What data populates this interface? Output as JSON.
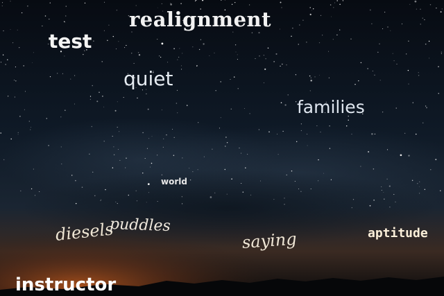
{
  "scene": {
    "description_type": "night-sky-photo",
    "colors": {
      "sky_top": "#070b12",
      "sky_mid": "#13202f",
      "cloud": "#1d2b3b",
      "horizon_glow": "#9a4a1a",
      "ground": "#07080a"
    }
  },
  "words": {
    "realignment": "realignment",
    "test": "test",
    "quiet": "quiet",
    "families": "families",
    "world": "world",
    "diesels": "diesels",
    "puddles": "puddles",
    "saying": "saying",
    "aptitude": "aptitude",
    "instructor": "instructor"
  }
}
